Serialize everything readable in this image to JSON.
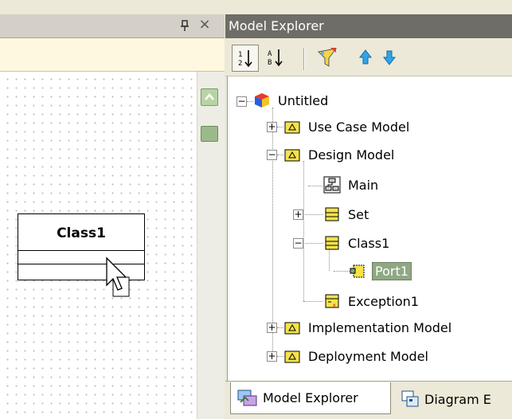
{
  "left_panel": {
    "pin_icon": "pin-icon",
    "close_glyph": "×",
    "class_box": {
      "name": "Class1"
    }
  },
  "model_explorer": {
    "title": "Model Explorer",
    "toolbar": {
      "sort_by_type_icon": "sort-by-type-icon",
      "sort_by_name_icon": "sort-by-name-icon",
      "filter_icon": "filter-icon",
      "move_up_icon": "arrow-up-icon",
      "move_down_icon": "arrow-down-icon"
    },
    "tree": {
      "root": "Untitled",
      "use_case_model": "Use Case Model",
      "design_model": "Design Model",
      "main": "Main",
      "set": "Set",
      "class1": "Class1",
      "port1": "Port1",
      "exception1": "Exception1",
      "implementation_model": "Implementation Model",
      "deployment_model": "Deployment Model"
    },
    "tabs": {
      "model_explorer": "Model Explorer",
      "diagram_explorer": "Diagram E"
    },
    "colors": {
      "selection": "#8fa884",
      "title_bar": "#6f6d67",
      "package": "#f4e34a"
    }
  }
}
